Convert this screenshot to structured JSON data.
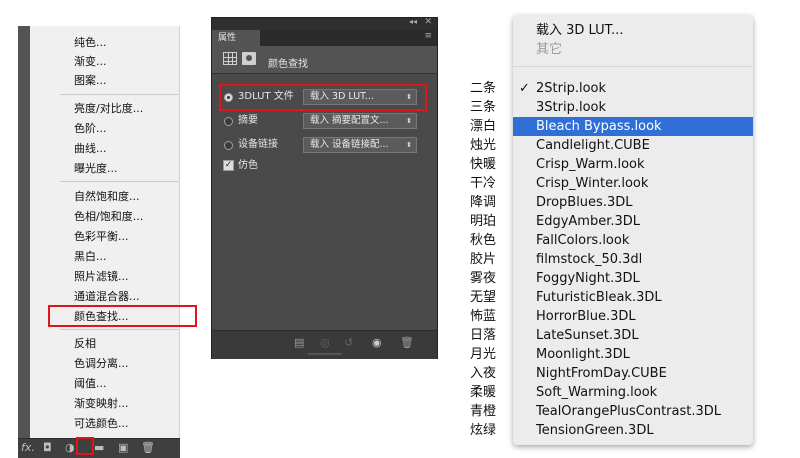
{
  "left_menu": {
    "items": [
      "纯色...",
      "渐变...",
      "图案...",
      "亮度/对比度...",
      "色阶...",
      "曲线...",
      "曝光度...",
      "自然饱和度...",
      "色相/饱和度...",
      "色彩平衡...",
      "黑白...",
      "照片滤镜...",
      "通道混合器...",
      "颜色查找...",
      "反相",
      "色调分离...",
      "阈值...",
      "渐变映射...",
      "可选颜色..."
    ],
    "highlighted_item": "颜色查找...",
    "bottom_bar": {
      "fx_label": "fx."
    }
  },
  "properties_panel": {
    "tab_label": "属性",
    "title": "颜色查找",
    "rows": [
      {
        "label": "3DLUT 文件",
        "value": "载入 3D LUT...",
        "selected": true
      },
      {
        "label": "摘要",
        "value": "载入 摘要配置文...",
        "selected": false
      },
      {
        "label": "设备链接",
        "value": "载入 设备链接配...",
        "selected": false
      }
    ],
    "dither": {
      "label": "仿色",
      "checked": true
    },
    "highlight_color": "#e0151c"
  },
  "cn_labels": [
    "二条",
    "三条",
    "漂白",
    "烛光",
    "快暖",
    "干冷",
    "降调",
    "明珀",
    "秋色",
    "胶片",
    "雾夜",
    "无望",
    "怖蓝",
    "日落",
    "月光",
    "入夜",
    "柔暖",
    "青橙",
    "炫绿"
  ],
  "lut_dropdown": {
    "header_items": [
      "载入 3D LUT...",
      "其它"
    ],
    "items": [
      "2Strip.look",
      "3Strip.look",
      "Bleach Bypass.look",
      "Candlelight.CUBE",
      "Crisp_Warm.look",
      "Crisp_Winter.look",
      "DropBlues.3DL",
      "EdgyAmber.3DL",
      "FallColors.look",
      "filmstock_50.3dl",
      "FoggyNight.3DL",
      "FuturisticBleak.3DL",
      "HorrorBlue.3DL",
      "LateSunset.3DL",
      "Moonlight.3DL",
      "NightFromDay.CUBE",
      "Soft_Warming.look",
      "TealOrangePlusContrast.3DL",
      "TensionGreen.3DL"
    ],
    "checked_item": "2Strip.look",
    "highlighted_item": "Bleach Bypass.look",
    "highlight_color": "#2f6fd6"
  }
}
